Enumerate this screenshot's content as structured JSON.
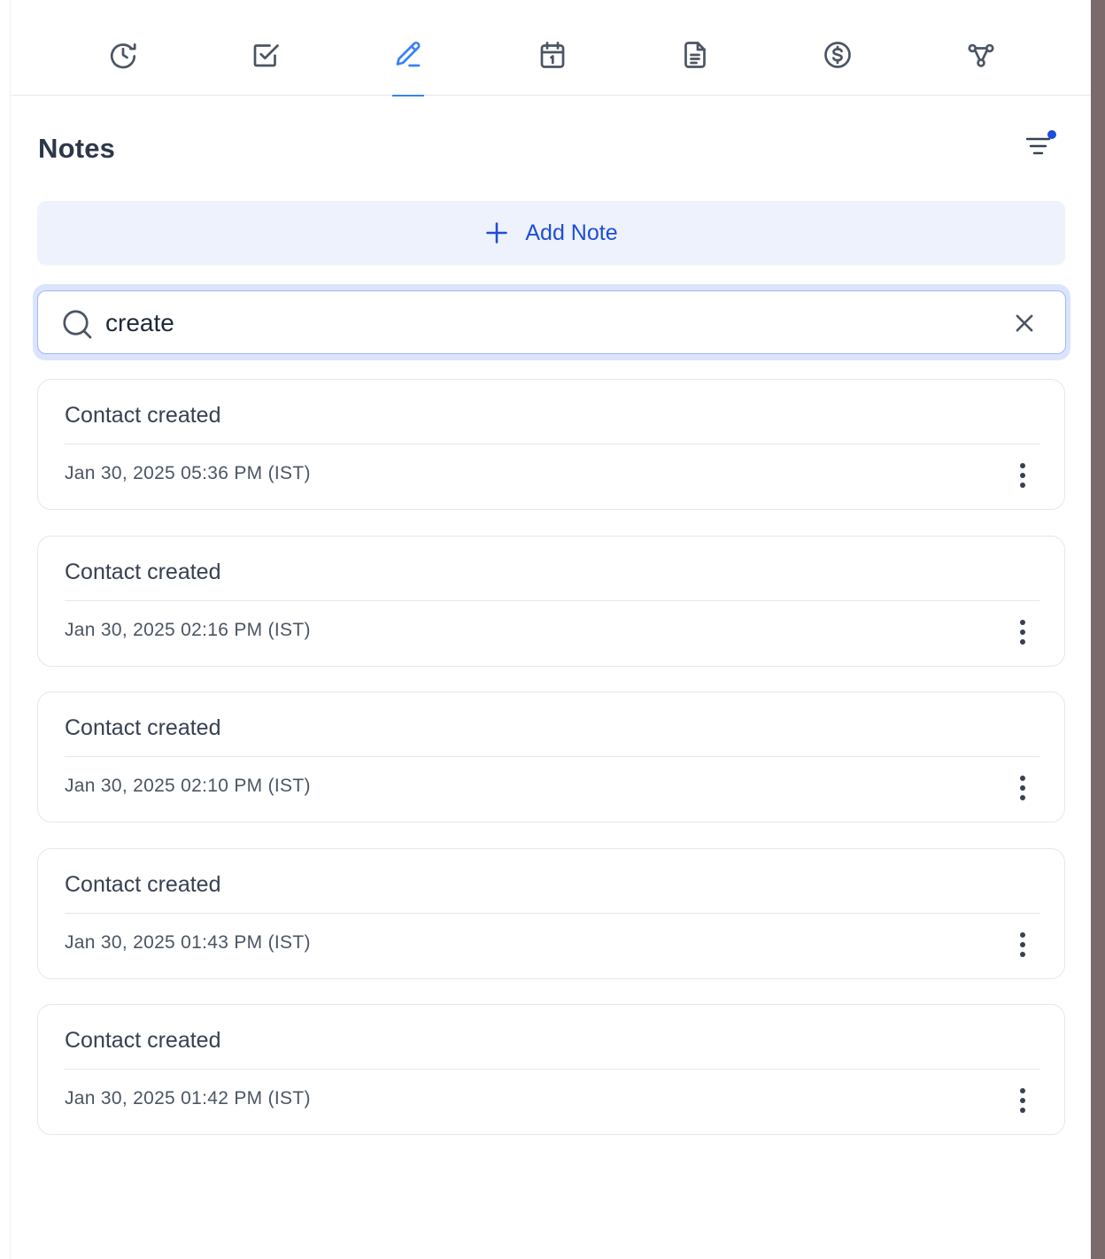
{
  "tabs": [
    {
      "icon": "history-icon",
      "active": false
    },
    {
      "icon": "task-check-icon",
      "active": false
    },
    {
      "icon": "pen-notes-icon",
      "active": true
    },
    {
      "icon": "calendar-icon",
      "active": false
    },
    {
      "icon": "document-icon",
      "active": false
    },
    {
      "icon": "dollar-icon",
      "active": false
    },
    {
      "icon": "workflow-icon",
      "active": false
    }
  ],
  "header": {
    "title": "Notes"
  },
  "add_note": {
    "label": "Add Note"
  },
  "search": {
    "value": "create"
  },
  "notes": [
    {
      "title": "Contact created",
      "date": "Jan 30, 2025 05:36 PM (IST)"
    },
    {
      "title": "Contact created",
      "date": "Jan 30, 2025 02:16 PM (IST)"
    },
    {
      "title": "Contact created",
      "date": "Jan 30, 2025 02:10 PM (IST)"
    },
    {
      "title": "Contact created",
      "date": "Jan 30, 2025 01:43 PM (IST)"
    },
    {
      "title": "Contact created",
      "date": "Jan 30, 2025 01:42 PM (IST)"
    }
  ],
  "colors": {
    "accent": "#1d4ed8",
    "active_tab": "#3b82f6",
    "filter_dot": "#1d4ed8",
    "icon": "#4b5563"
  }
}
